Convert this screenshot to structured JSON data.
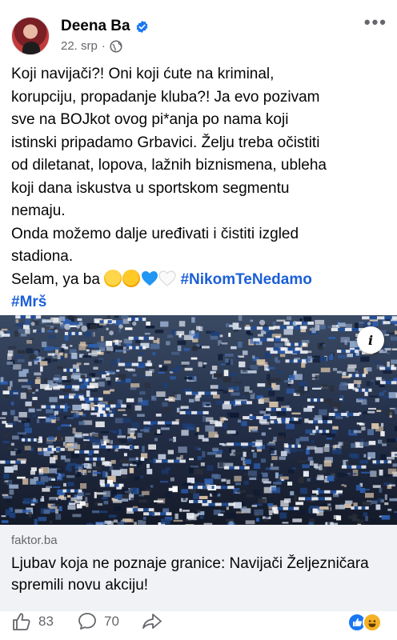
{
  "post": {
    "author": "Deena Ba",
    "date": "22. srp",
    "separator": "·",
    "more_label": "•••",
    "text_lines": [
      "Koji navijači?! Oni koji ćute na kriminal,",
      "korupciju, propadanje kluba?! Ja evo pozivam",
      "sve na BOJkot ovog pi*anja po nama koji",
      "istinski pripadamo Grbavici. Želju treba očistiti",
      "od diletanat, lopova, lažnih biznismena, ubleha",
      "koji dana iskustva u sportskom segmentu",
      "nemaju.",
      "Onda možemo dalje uređivati i čistiti izgled",
      "stadiona."
    ],
    "closing": "Selam, ya ba",
    "hashtags": [
      "#NikomTeNedamo",
      "#Mrš"
    ],
    "icons": {
      "verified": "verified-badge-icon",
      "privacy": "globe-icon",
      "emojis": [
        "grinning-sweat-emoji",
        "rolling-laughing-emoji",
        "blue-heart-emoji",
        "white-heart-emoji"
      ]
    }
  },
  "link_preview": {
    "info_label": "i",
    "domain": "faktor.ba",
    "title": "Ljubav koja ne poznaje granice: Navijači Željezničara spremili novu akciju!"
  },
  "footer": {
    "likes": "83",
    "comments": "70",
    "reaction_icons": [
      "like-reaction-icon",
      "haha-reaction-icon"
    ]
  },
  "colors": {
    "accent": "#1877f2",
    "hashtag": "#1b5fd8",
    "secondary_text": "#65676b",
    "card_bg": "#f0f2f5"
  }
}
